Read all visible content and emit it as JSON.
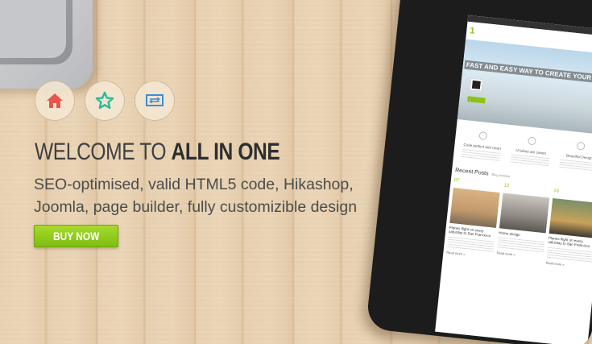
{
  "icons": [
    {
      "name": "home-icon",
      "color": "#e4574b"
    },
    {
      "name": "star-icon",
      "color": "#2bb89a"
    },
    {
      "name": "monitor-icon",
      "color": "#3a8fd6"
    }
  ],
  "hero": {
    "headline_prefix": "WELCOME TO ",
    "headline_bold": "ALL IN ONE",
    "line1": "SEO-optimised, valid HTML5 code, Hikashop,",
    "line2": "Joomla, page builder, fully customizible design",
    "buy_label": "BUY NOW"
  },
  "tablet_screen": {
    "hero_title": "FAST AND EASY WAY TO CREATE YOUR WEBSITE",
    "features": [
      {
        "title": "Code perfect and clean"
      },
      {
        "title": "UI ideas are saved"
      },
      {
        "title": "Beautiful Design"
      }
    ],
    "recent_posts_title": "Recent Posts",
    "recent_posts_sub": "Blog timeline",
    "posts": [
      {
        "date": "07",
        "title": "Planes flight on every saturday to San Francisco",
        "more": "Read more »"
      },
      {
        "date": "12",
        "title": "Home design",
        "more": "Read more »"
      },
      {
        "date": "16",
        "title": "Planes flight on every saturday to San Francisco",
        "more": "Read more »"
      }
    ]
  },
  "colors": {
    "accent_green": "#8ec21a",
    "headline": "#3f3f3f"
  }
}
